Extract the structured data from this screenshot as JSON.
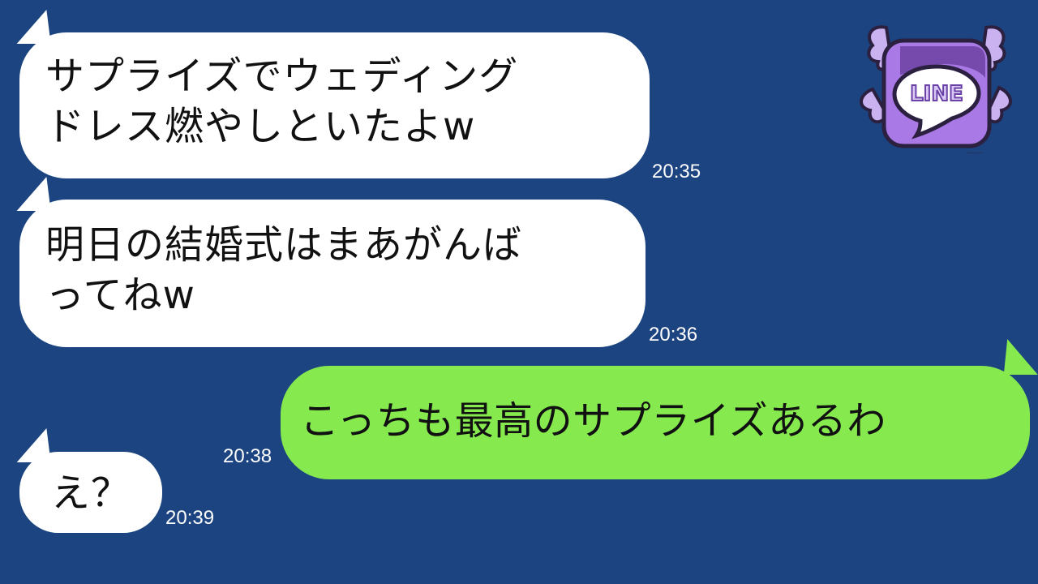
{
  "messages": [
    {
      "direction": "incoming",
      "text": "サプライズでウェディング\nドレス燃やしといたよw",
      "time": "20:35"
    },
    {
      "direction": "incoming",
      "text": "明日の結婚式はまあがんば\nってねw",
      "time": "20:36"
    },
    {
      "direction": "outgoing",
      "text": "こっちも最高のサプライズあるわ",
      "time": "20:38"
    },
    {
      "direction": "incoming",
      "text": "え？",
      "time": "20:39"
    }
  ],
  "logo": {
    "text": "LINE"
  },
  "colors": {
    "background": "#1b4480",
    "incoming_bubble": "#ffffff",
    "outgoing_bubble": "#86ea4f",
    "time_text": "#ffffff",
    "logo_purple": "#a979e6",
    "logo_wing": "#c9b2ef"
  },
  "icons": [
    "line-logo-icon"
  ]
}
